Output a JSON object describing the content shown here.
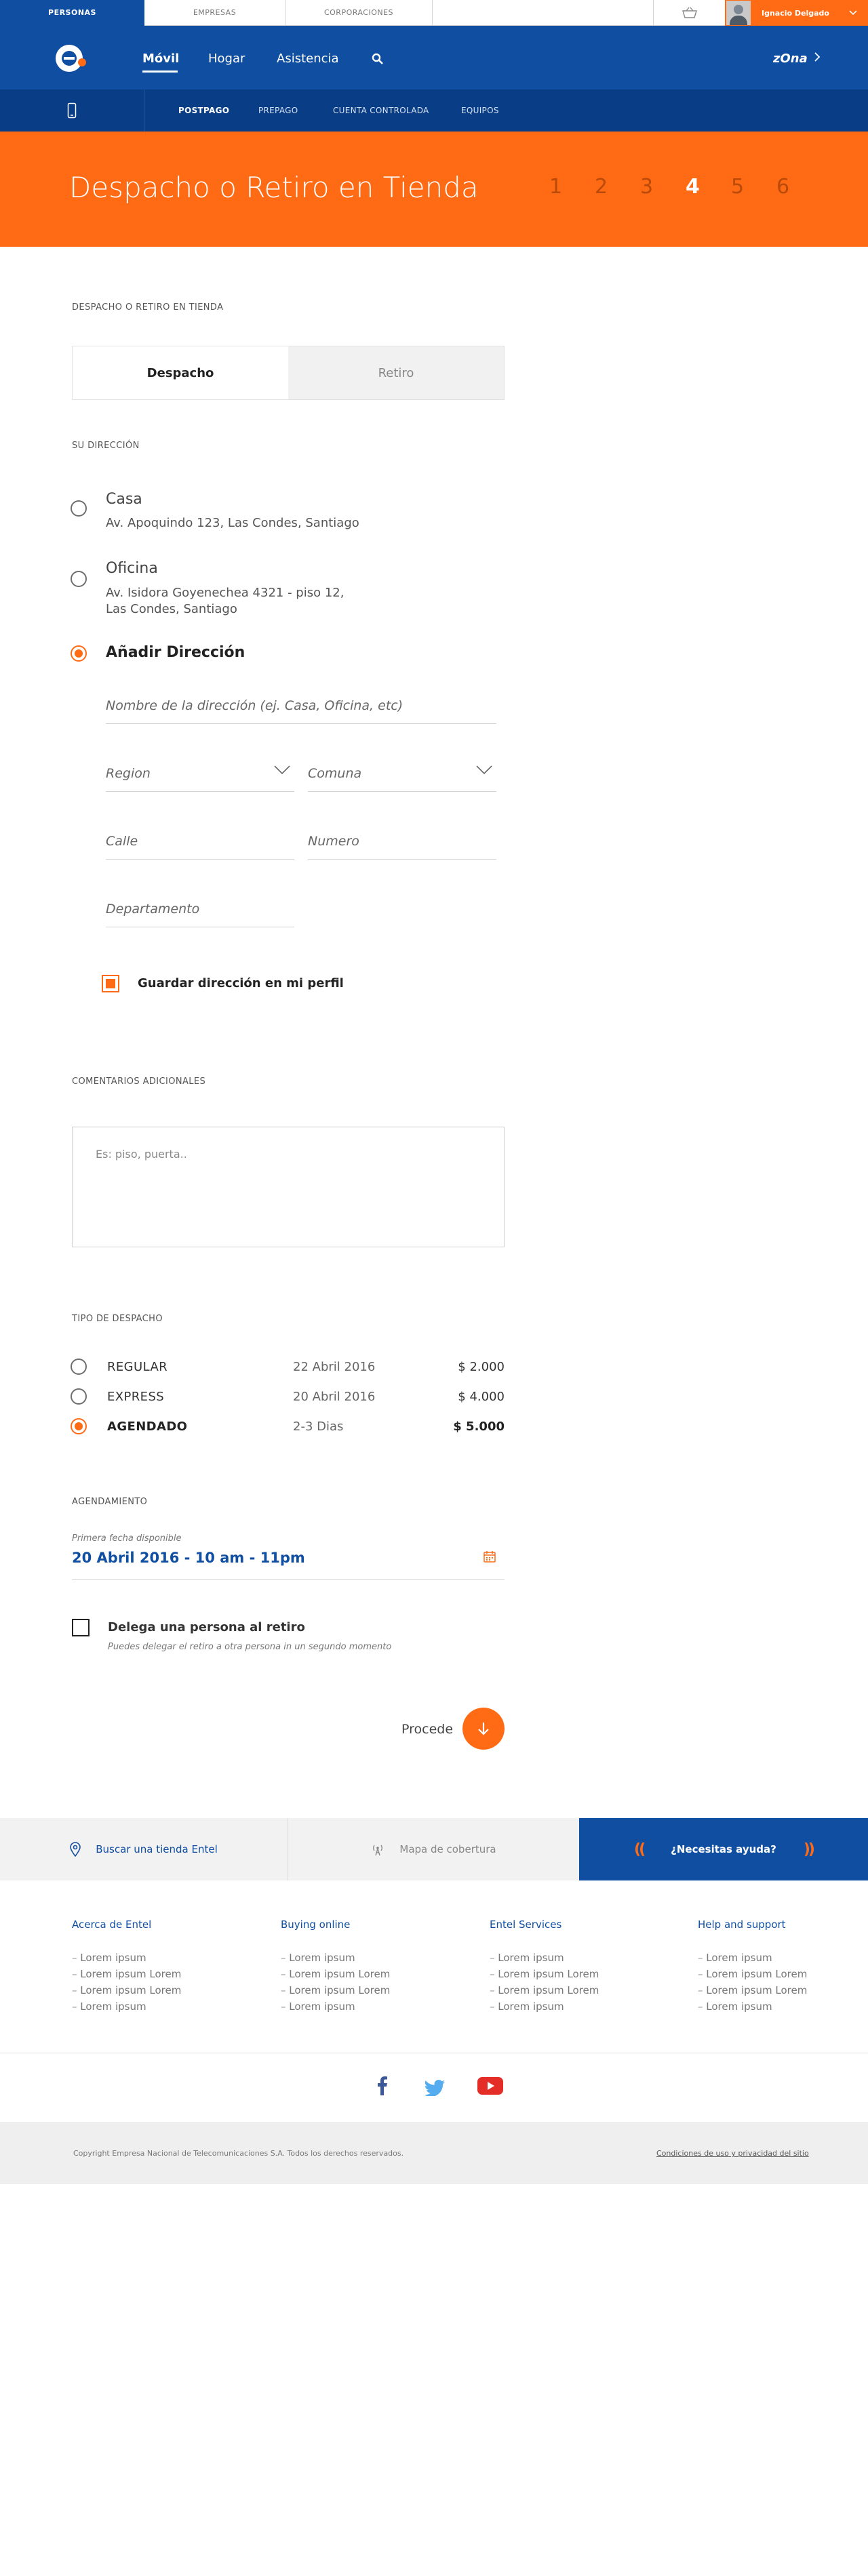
{
  "topbar": {
    "segments": [
      "PERSONAS",
      "EMPRESAS",
      "CORPORACIONES"
    ],
    "user_name": "Ignacio Delgado"
  },
  "mainnav": {
    "links": [
      "Móvil",
      "Hogar",
      "Asistencia"
    ],
    "zona": "zOna"
  },
  "subnav": {
    "links": [
      "POSTPAGO",
      "PREPAGO",
      "CUENTA CONTROLADA",
      "EQUIPOS"
    ]
  },
  "hero": {
    "title": "Despacho o Retiro en Tienda",
    "steps": [
      "1",
      "2",
      "3",
      "4",
      "5",
      "6"
    ],
    "active_step": "4"
  },
  "form": {
    "section_title": "DESPACHO O RETIRO EN TIENDA",
    "tabs": [
      "Despacho",
      "Retiro"
    ],
    "address_section": "SU DIRECCIÓN",
    "addresses": [
      {
        "name": "Casa",
        "lines": [
          "Av. Apoquindo 123, Las Condes, Santiago"
        ]
      },
      {
        "name": "Oficina",
        "lines": [
          "Av. Isidora Goyenechea 4321 - piso 12,",
          "Las Condes, Santiago"
        ]
      }
    ],
    "add_address": "Añadir Dirección",
    "fields": {
      "address_name": "Nombre de la dirección (ej. Casa, Oficina, etc)",
      "region": "Region",
      "comuna": "Comuna",
      "calle": "Calle",
      "numero": "Numero",
      "departamento": "Departamento"
    },
    "save_address": "Guardar dirección en mi perfil",
    "comments_section": "COMENTARIOS ADICIONALES",
    "comments_placeholder": "Es: piso, puerta..",
    "shipping_section": "TIPO DE DESPACHO",
    "shipping_options": [
      {
        "name": "REGULAR",
        "date": "22 Abril 2016",
        "price": "$ 2.000"
      },
      {
        "name": "EXPRESS",
        "date": "20 Abril 2016",
        "price": "$ 4.000"
      },
      {
        "name": "AGENDADO",
        "date": "2-3 Dias",
        "price": "$ 5.000"
      }
    ],
    "selected_shipping": "AGENDADO",
    "schedule_section": "AGENDAMIENTO",
    "schedule_hint": "Primera fecha disponible",
    "schedule_value": "20 Abril 2016 - 10 am - 11pm",
    "delegate_label": "Delega una persona al retiro",
    "delegate_hint": "Puedes delegar el retiro a otra persona in un segundo momento",
    "proceed": "Procede"
  },
  "servicebar": {
    "store": "Buscar una tienda Entel",
    "map": "Mapa de cobertura",
    "help": "¿Necesitas ayuda?"
  },
  "footer": {
    "columns": [
      {
        "title": "Acerca de Entel",
        "items": [
          "Lorem ipsum",
          "Lorem ipsum Lorem",
          "Lorem ipsum Lorem",
          "Lorem ipsum"
        ]
      },
      {
        "title": "Buying online",
        "items": [
          "Lorem ipsum",
          "Lorem ipsum Lorem",
          "Lorem ipsum Lorem",
          "Lorem ipsum"
        ]
      },
      {
        "title": "Entel Services",
        "items": [
          "Lorem ipsum",
          "Lorem ipsum Lorem",
          "Lorem ipsum Lorem",
          "Lorem ipsum"
        ]
      },
      {
        "title": "Help and support",
        "items": [
          "Lorem ipsum",
          "Lorem ipsum Lorem",
          "Lorem ipsum Lorem",
          "Lorem ipsum"
        ]
      }
    ],
    "copyright": "Copyright Empresa Nacional de Telecomunicaciones S.A. Todos los derechos reservados.",
    "privacy": "Condiciones de uso y privacidad del sitio"
  },
  "colors": {
    "brand_blue": "#0f4ea1",
    "brand_orange": "#ff6a14"
  }
}
